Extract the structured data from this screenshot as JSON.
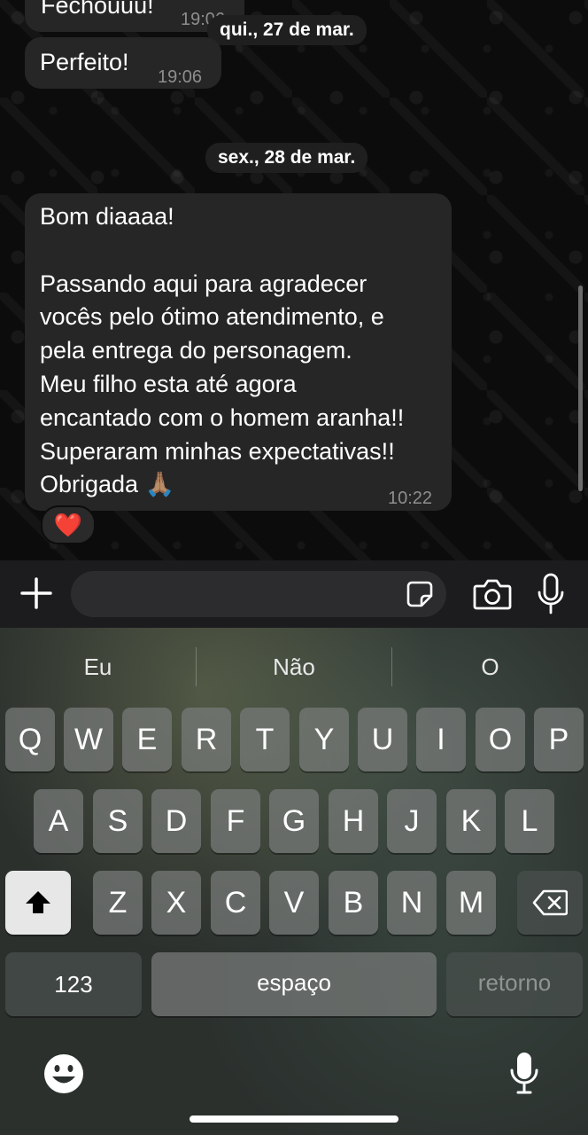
{
  "chat": {
    "partial_message": {
      "text": "Fechouuu!",
      "time": "19:06"
    },
    "date1": "qui., 27 de mar.",
    "message1": {
      "text": "Perfeito!",
      "time": "19:06"
    },
    "date2": "sex., 28 de mar.",
    "message2": {
      "text": "Bom diaaaa!\n\nPassando aqui para agradecer\nvocês pelo ótimo atendimento, e\npela entrega do personagem.\nMeu filho esta até agora\nencantado com o homem aranha!!\nSuperaram minhas expectativas!!\nObrigada 🙏🏽",
      "time": "10:22",
      "reaction": "❤️"
    }
  },
  "composer": {
    "placeholder": ""
  },
  "keyboard": {
    "suggestions": [
      "Eu",
      "Não",
      "O"
    ],
    "row1": [
      "Q",
      "W",
      "E",
      "R",
      "T",
      "Y",
      "U",
      "I",
      "O",
      "P"
    ],
    "row2": [
      "A",
      "S",
      "D",
      "F",
      "G",
      "H",
      "J",
      "K",
      "L"
    ],
    "row3": [
      "Z",
      "X",
      "C",
      "V",
      "B",
      "N",
      "M"
    ],
    "numbers_label": "123",
    "space_label": "espaço",
    "return_label": "retorno"
  },
  "colors": {
    "bubble": "#262626",
    "chat_bg": "#0c0c0c",
    "timestamp": "#8e8e8e"
  }
}
